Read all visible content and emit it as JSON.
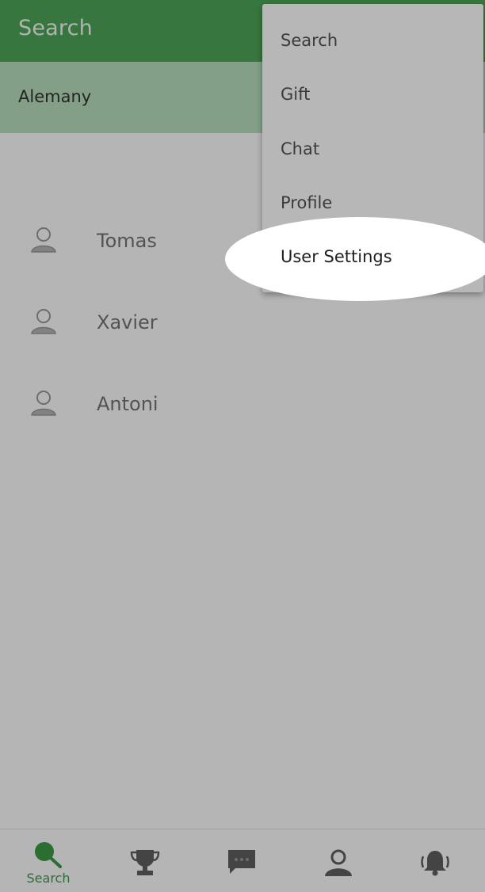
{
  "appbar": {
    "title": "Search"
  },
  "subheader": {
    "label": "Alemany"
  },
  "users": [
    {
      "name": "Tomas"
    },
    {
      "name": "Xavier"
    },
    {
      "name": "Antoni"
    }
  ],
  "menu": {
    "items": [
      {
        "label": "Search"
      },
      {
        "label": "Gift"
      },
      {
        "label": "Chat"
      },
      {
        "label": "Profile"
      },
      {
        "label": "User Settings"
      }
    ],
    "highlighted": "User Settings"
  },
  "bottom_nav": {
    "items": [
      {
        "icon": "search-icon",
        "label": "Search",
        "active": true
      },
      {
        "icon": "trophy-icon",
        "active": false
      },
      {
        "icon": "chat-icon",
        "active": false
      },
      {
        "icon": "person-icon",
        "active": false
      },
      {
        "icon": "bell-icon",
        "active": false
      }
    ],
    "active_color": "#3c9b47",
    "inactive_color": "#606060"
  },
  "colors": {
    "appbar": "#4fa65a",
    "subheader": "#b9e0bd",
    "scrim": "rgba(0,0,0,0.29)"
  }
}
